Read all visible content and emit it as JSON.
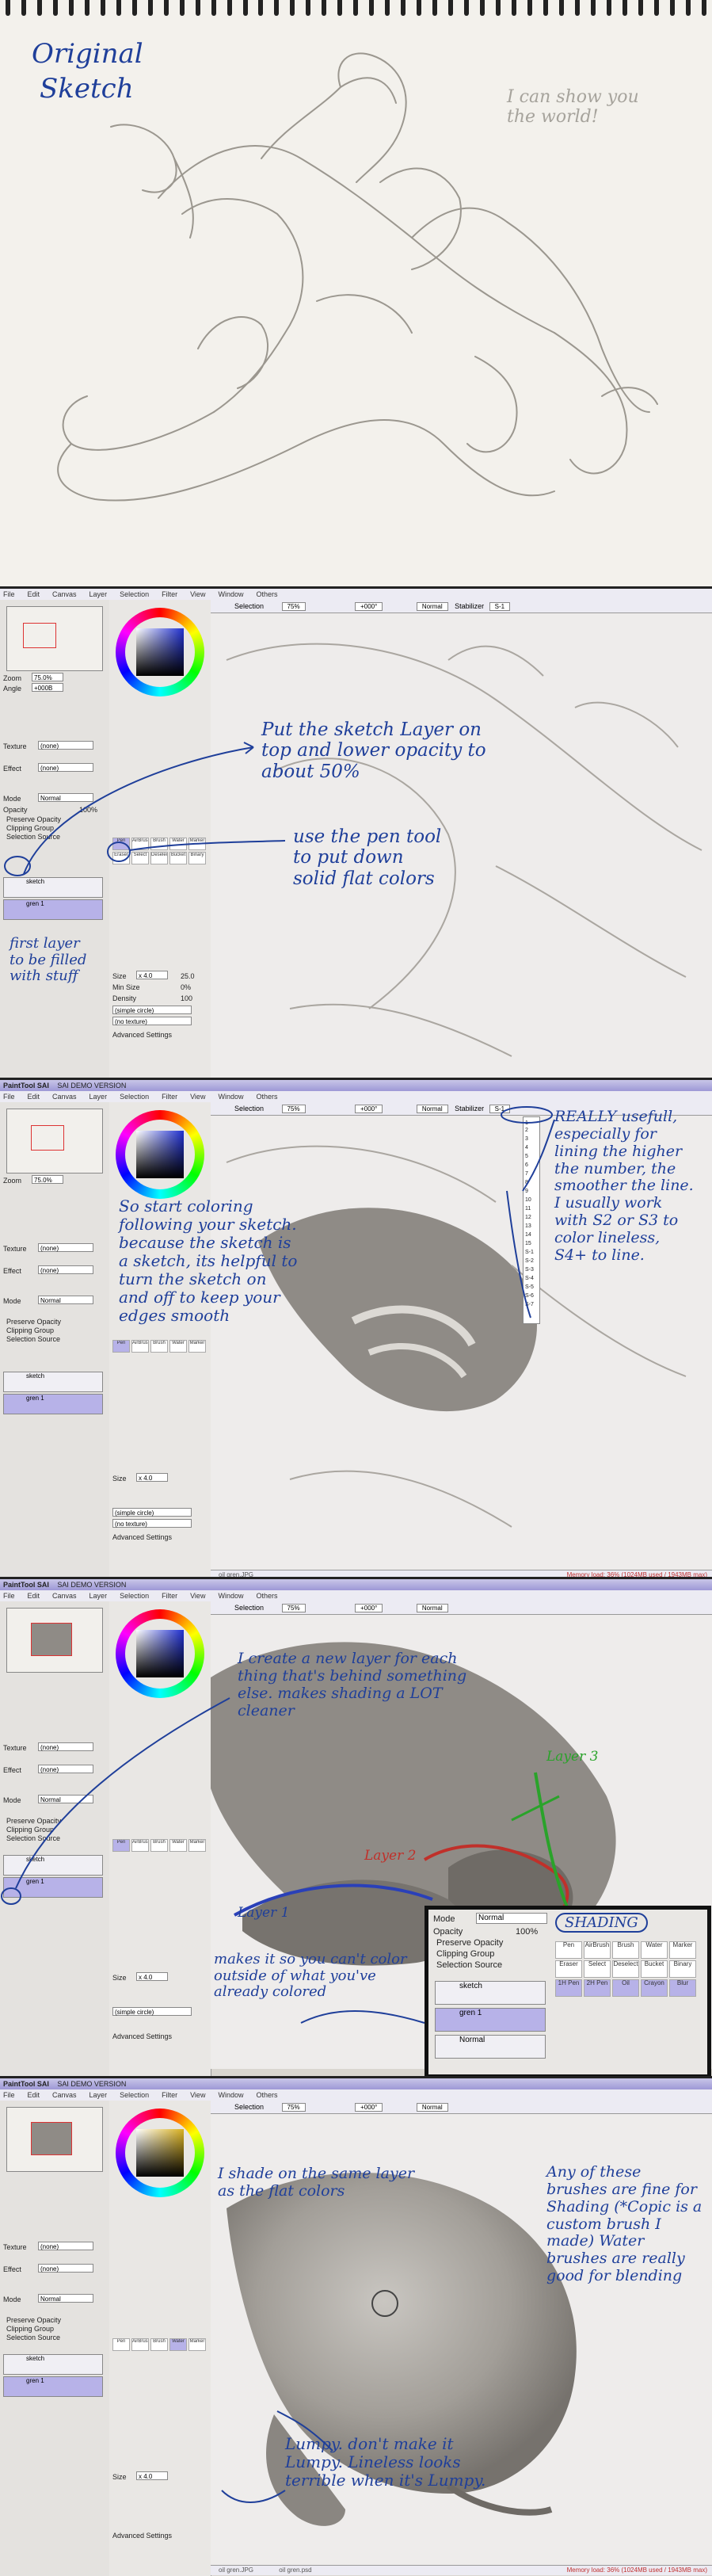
{
  "sketch": {
    "title_line1": "Original",
    "title_line2": "Sketch",
    "pencil_note": "I can show you the world!"
  },
  "app": {
    "logo": "PaintTool SAI",
    "title": "SAI DEMO VERSION ",
    "file_tab": "oil gren.JPG",
    "menus": [
      "File",
      "Edit",
      "Canvas",
      "Layer",
      "Selection",
      "Filter",
      "View",
      "Window",
      "Others"
    ],
    "selection_label": "Selection",
    "zoom": "75%",
    "angle": "+000°",
    "blend": "Normal",
    "stabilizer_label": "Stabilizer",
    "stabilizer_value": "S-1",
    "stabilizer_options": [
      "1",
      "2",
      "3",
      "4",
      "5",
      "6",
      "7",
      "8",
      "9",
      "10",
      "11",
      "12",
      "13",
      "14",
      "15",
      "S-1",
      "S-2",
      "S-3",
      "S-4",
      "S-5",
      "S-6",
      "S-7"
    ],
    "nav": {
      "zoom_label": "Zoom",
      "zoom": "75.0%",
      "angle_label": "Angle",
      "angle": "+000B"
    },
    "texture_label": "Texture",
    "effect_label": "Effect",
    "none": "(none)",
    "mode_label": "Mode",
    "mode": "Normal",
    "opacity_label": "Opacity",
    "opacity": "100%",
    "checks": [
      "Preserve Opacity",
      "Clipping Group",
      "Selection Source"
    ],
    "tools": [
      "Pen",
      "AirBrush",
      "Brush",
      "Water",
      "Marker",
      "Eraser",
      "Select",
      "Deselect",
      "Bucket",
      "Binary",
      "1H Pen",
      "2H Pen",
      "Oil",
      "Crayon",
      "Blur"
    ],
    "brush": {
      "mode": "Normal",
      "size_label": "Size",
      "size": "x 4.0",
      "size_val": "25.0",
      "minsize_label": "Min Size",
      "minsize": "0%",
      "density_label": "Density",
      "density": "100",
      "shape": "(simple circle)",
      "texture": "(no texture)",
      "advanced": "Advanced Settings"
    },
    "layers": {
      "p1": [
        "sketch",
        "gren 1"
      ],
      "layer_mode": "Normal",
      "layer_opac": "100%"
    },
    "status_left": "oil gren.JPG",
    "status_right": "Memory load: 36% (1024MB used / 1943MB max)",
    "gren_png": "oil gren.psd"
  },
  "notes": {
    "p1_a": "Put the sketch Layer on top and lower opacity to about 50%",
    "p1_b": "use the pen tool to put down solid flat colors",
    "p1_c": "first layer to be filled with stuff",
    "p2_a": "So start coloring following your sketch. because the sketch is a sketch, its helpful to turn the sketch on and off to keep your edges smooth",
    "p2_b": "REALLY usefull, especially for lining the higher the number, the smoother the line. I usually work with S2 or S3 to color lineless, S4+ to line.",
    "p3_a": "I create a new layer for each thing that's behind something else. makes shading a LOT cleaner",
    "p3_layer1": "Layer 1",
    "p3_layer2": "Layer 2",
    "p3_layer3": "Layer 3",
    "p3_b": "makes it so you can't color outside of what you've already colored",
    "p4_a": "I shade on the same layer as the flat colors",
    "p4_b": "Any of these brushes are fine for Shading (*Copic is a custom brush I made) Water brushes are really good for blending",
    "p4_c": "Lumpy. don't make it Lumpy. Lineless looks terrible when it's Lumpy.",
    "shading": "SHADING"
  },
  "colors": {
    "note_blue": "#1f3f9a",
    "layer_select": "#b7b2e8",
    "titlebar": "#9d98d6",
    "red_line": "#c0302a",
    "green_line": "#2aa32a"
  }
}
